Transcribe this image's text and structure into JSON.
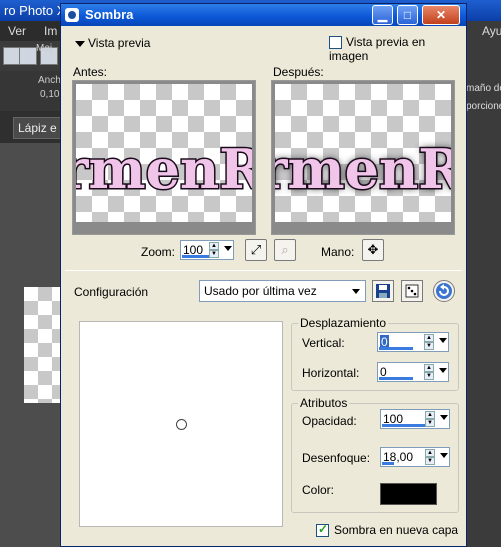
{
  "background_app": {
    "title": "ro Photo X",
    "menu": [
      "Ver",
      "Im"
    ],
    "right_menu": "Ayu",
    "toolbar_label": "Anch",
    "toolbar_value": "0,10",
    "mej": "Mej",
    "right_text1": "maño de",
    "right_text2": "porciones",
    "lapiz_label": "Lápiz e"
  },
  "dialog": {
    "title": "Sombra",
    "vista_previa_label": "Vista previa",
    "vista_previa_imagen_label": "Vista previa en imagen",
    "antes_label": "Antes:",
    "despues_label": "Después:",
    "preview_text": "rmenRo",
    "zoom_label": "Zoom:",
    "zoom_value": "100",
    "mano_label": "Mano:",
    "configuracion_label": "Configuración",
    "configuracion_value": "Usado por última vez",
    "desplazamiento": {
      "title": "Desplazamiento",
      "vertical_label": "Vertical:",
      "vertical_value": "0",
      "horizontal_label": "Horizontal:",
      "horizontal_value": "0"
    },
    "atributos": {
      "title": "Atributos",
      "opacidad_label": "Opacidad:",
      "opacidad_value": "100",
      "desenfoque_label": "Desenfoque:",
      "desenfoque_value": "18,00",
      "color_label": "Color:",
      "color_value": "#000000"
    },
    "sombra_nueva_capa_label": "Sombra en nueva capa",
    "sombra_nueva_capa_checked": true,
    "vista_previa_imagen_checked": false
  },
  "colors": {
    "titlebar": "#0b56d6",
    "dialog_bg": "#ece9d8",
    "text_fill": "#f1c4ea",
    "text_stroke": "#1a0b1a"
  }
}
